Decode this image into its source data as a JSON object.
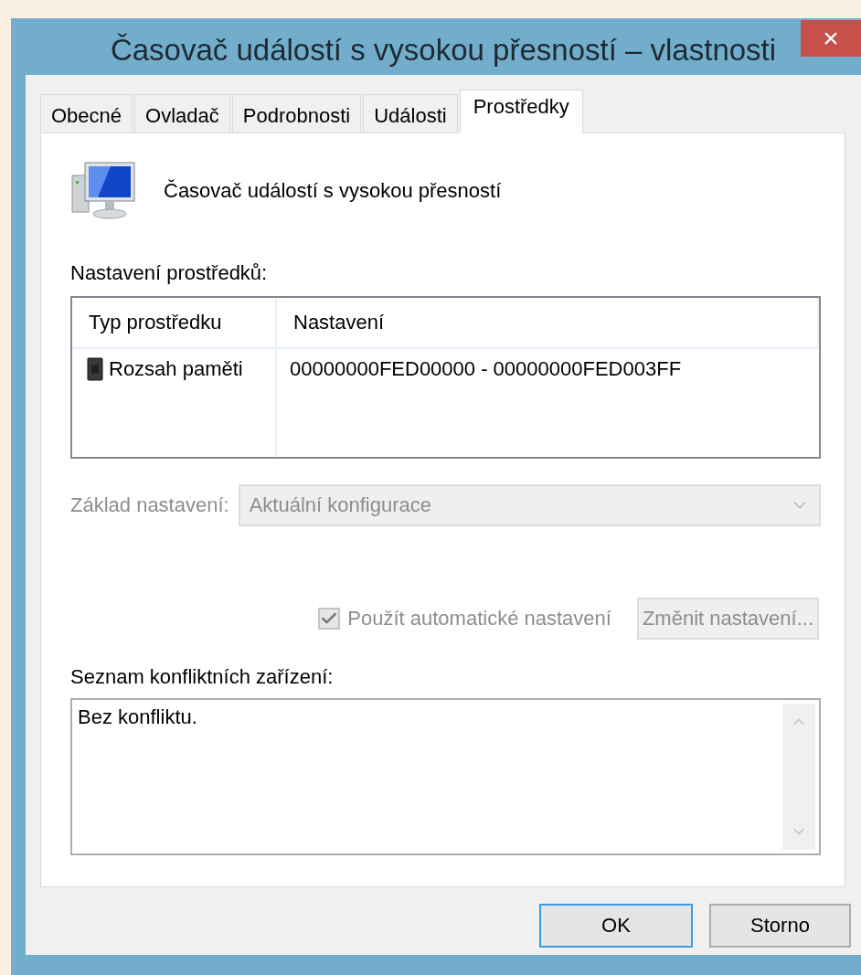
{
  "window": {
    "title": "Časovač událostí s vysokou přesností – vlastnosti",
    "close": "×"
  },
  "tabs": [
    {
      "label": "Obecné",
      "selected": false
    },
    {
      "label": "Ovladač",
      "selected": false
    },
    {
      "label": "Podrobnosti",
      "selected": false
    },
    {
      "label": "Události",
      "selected": false
    },
    {
      "label": "Prostředky",
      "selected": true
    }
  ],
  "device": {
    "name": "Časovač událostí s vysokou přesností"
  },
  "resource_settings": {
    "label": "Nastavení prostředků:",
    "columns": [
      "Typ prostředku",
      "Nastavení"
    ],
    "rows": [
      {
        "type": "Rozsah paměti",
        "setting": "00000000FED00000 - 00000000FED003FF"
      }
    ]
  },
  "settings_based_on": {
    "label": "Základ nastavení:",
    "value": "Aktuální konfigurace",
    "disabled": true
  },
  "auto_settings": {
    "label": "Použít automatické nastavení",
    "checked": true,
    "disabled": true
  },
  "change_button": {
    "label": "Změnit nastavení...",
    "disabled": true
  },
  "conflicts": {
    "label": "Seznam konfliktních zařízení:",
    "text": "Bez konfliktu."
  },
  "buttons": [
    {
      "label": "OK",
      "focused": true
    },
    {
      "label": "Storno",
      "focused": false
    }
  ]
}
